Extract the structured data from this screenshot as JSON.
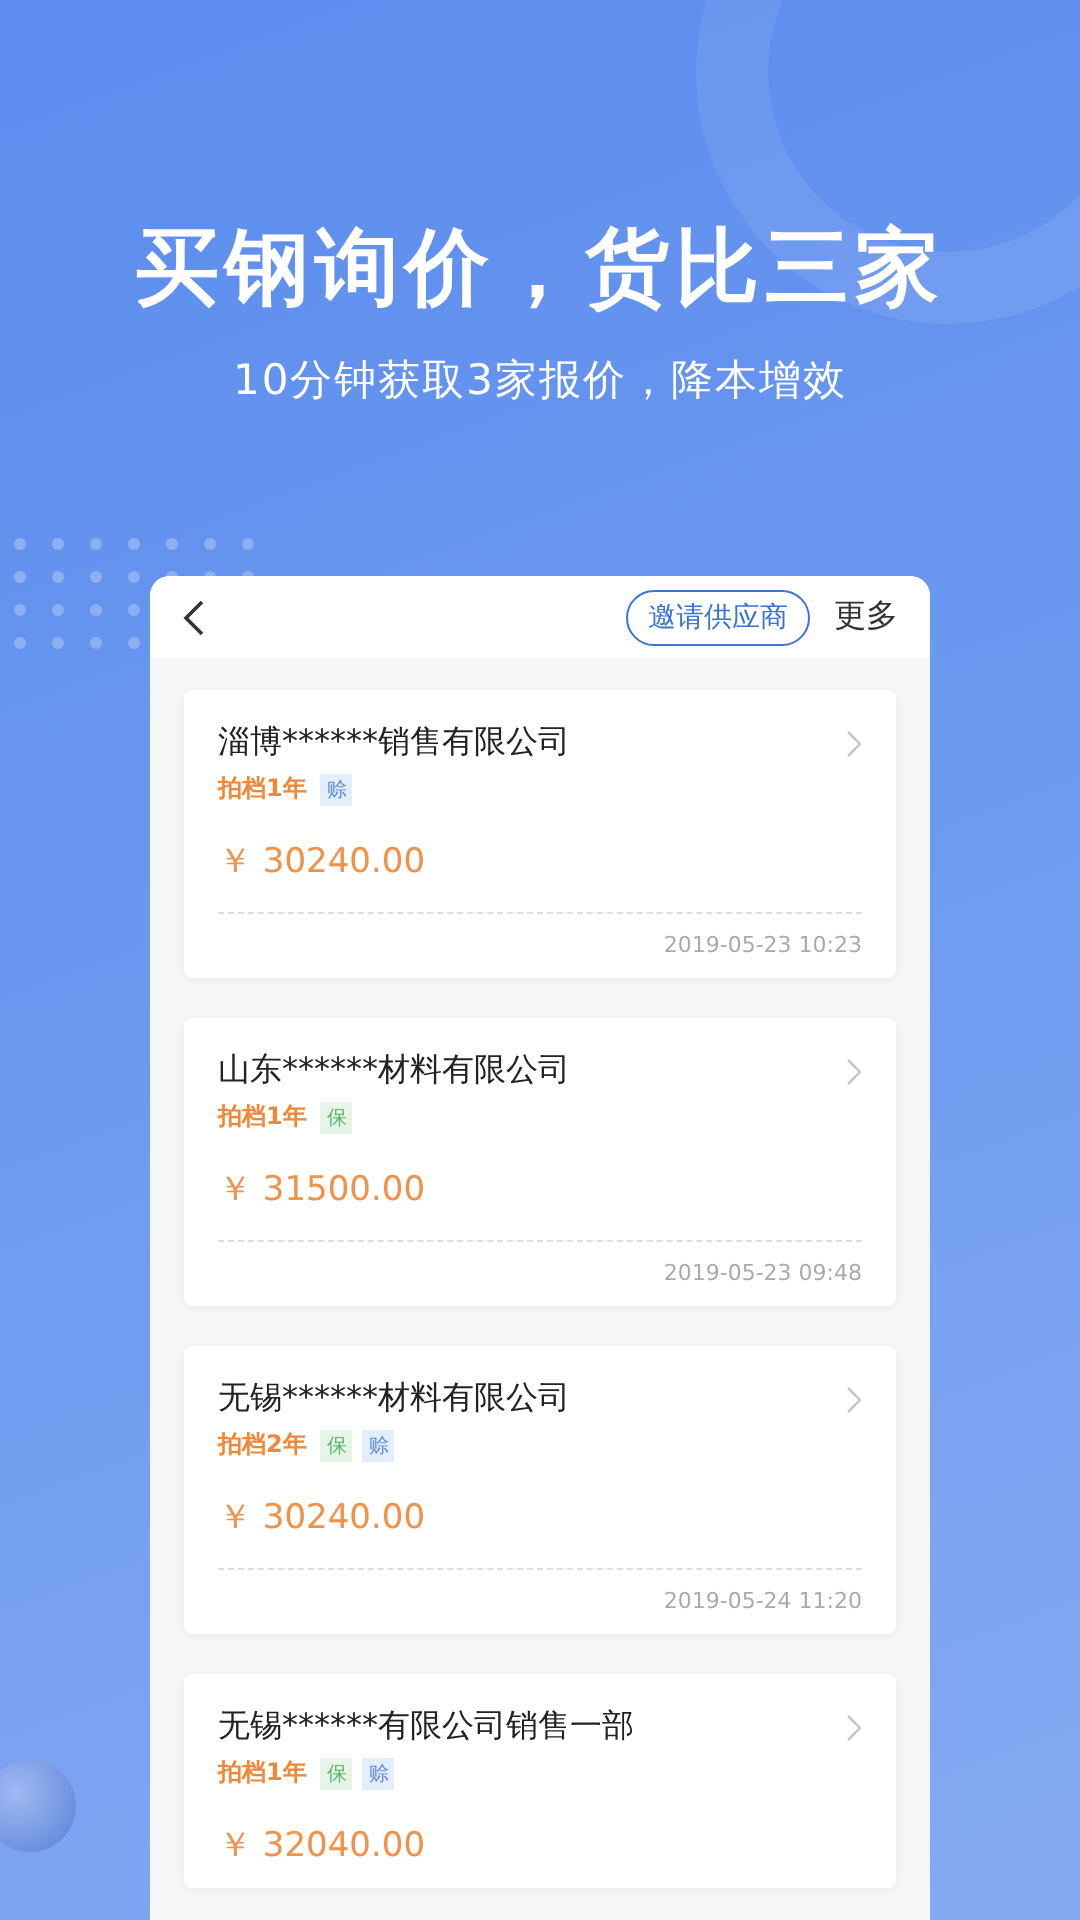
{
  "headline": "买钢询价，货比三家",
  "subheadline": "10分钟获取3家报价，降本增效",
  "phone": {
    "invite_button": "邀请供应商",
    "more": "更多",
    "quotes": [
      {
        "company": "淄博******销售有限公司",
        "years": "拍档1年",
        "tags": [
          {
            "kind": "credit",
            "label": "赊"
          }
        ],
        "price": "￥ 30240.00",
        "time": "2019-05-23 10:23"
      },
      {
        "company": "山东******材料有限公司",
        "years": "拍档1年",
        "tags": [
          {
            "kind": "guarantee",
            "label": "保"
          }
        ],
        "price": "￥ 31500.00",
        "time": "2019-05-23 09:48"
      },
      {
        "company": "无锡******材料有限公司",
        "years": "拍档2年",
        "tags": [
          {
            "kind": "guarantee",
            "label": "保"
          },
          {
            "kind": "credit",
            "label": "赊"
          }
        ],
        "price": "￥ 30240.00",
        "time": "2019-05-24 11:20"
      },
      {
        "company": "无锡******有限公司销售一部",
        "years": "拍档1年",
        "tags": [
          {
            "kind": "guarantee",
            "label": "保"
          },
          {
            "kind": "credit",
            "label": "赊"
          }
        ],
        "price": "￥ 32040.00"
      }
    ]
  }
}
